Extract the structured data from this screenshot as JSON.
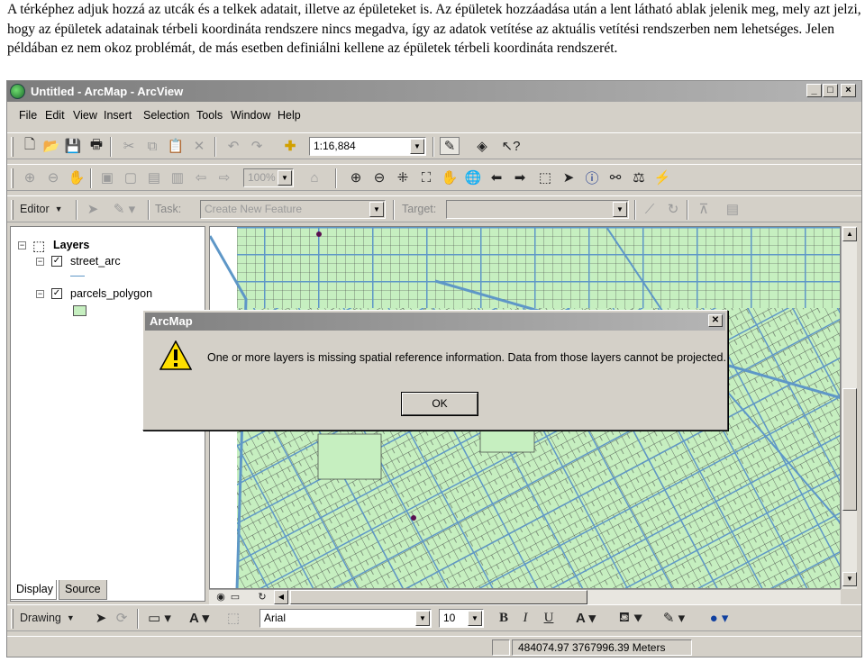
{
  "intro_text": "A térképhez adjuk hozzá az utcák és a telkek adatait, illetve az épületeket is. Az épületek hozzáadása után a lent látható ablak jelenik meg, mely azt jelzi, hogy az épületek adatainak térbeli koordináta rendszere nincs megadva, így az adatok vetítése az aktuális vetítési rendszerben nem lehetséges. Jelen példában ez nem okoz problémát, de más esetben definiálni kellene az épületek térbeli koordináta rendszerét.",
  "window": {
    "title": "Untitled - ArcMap - ArcView"
  },
  "menu": [
    "File",
    "Edit",
    "View",
    "Insert",
    "Selection",
    "Tools",
    "Window",
    "Help"
  ],
  "standard_toolbar": {
    "scale": "1:16,884"
  },
  "layout_toolbar": {
    "zoom": "100%"
  },
  "editor_toolbar": {
    "editor_label": "Editor",
    "task_label": "Task:",
    "task_value": "Create New Feature",
    "target_label": "Target:"
  },
  "toc": {
    "root": "Layers",
    "layers": [
      {
        "name": "street_arc",
        "checked": true
      },
      {
        "name": "parcels_polygon",
        "checked": true
      }
    ],
    "tabs": [
      "Display",
      "Source"
    ]
  },
  "drawing_toolbar": {
    "drawing_label": "Drawing",
    "font": "Arial",
    "size": "10",
    "bold": "B",
    "italic": "I",
    "underline": "U"
  },
  "status": {
    "coords": "484074.97  3767996.39 Meters"
  },
  "dialog": {
    "title": "ArcMap",
    "message": "One or more layers is missing spatial reference information.  Data from those layers cannot be projected.",
    "ok": "OK"
  },
  "colors": {
    "parcel_fill": "#c6efc0",
    "street": "#5e97c7",
    "title_bar": "#8a8a8a"
  }
}
